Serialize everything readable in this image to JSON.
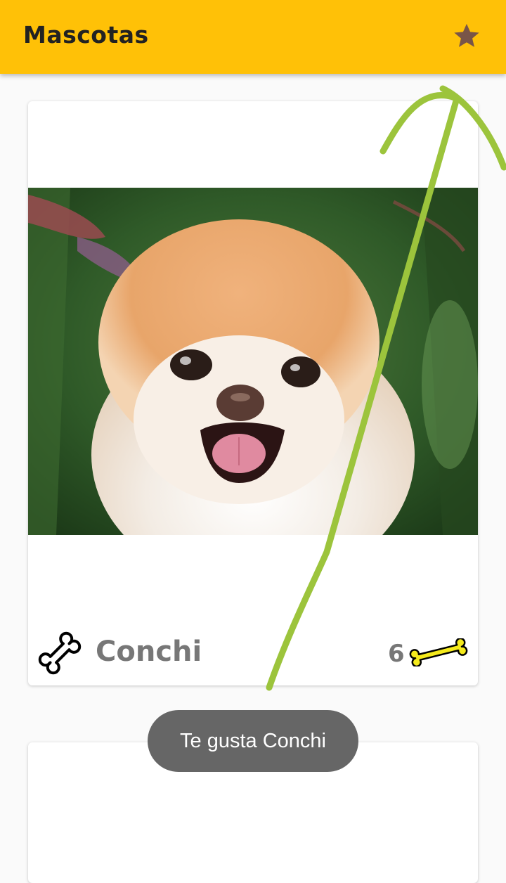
{
  "appbar": {
    "title": "Mascotas",
    "favorites_icon": "star-icon"
  },
  "pets": [
    {
      "name": "Conchi",
      "likes": "6",
      "rate_icon": "bone-outline-icon",
      "likes_icon": "yellow-bone-icon"
    }
  ],
  "toast": {
    "message": "Te gusta Conchi"
  },
  "colors": {
    "appbar": "#ffc107",
    "star": "#795548",
    "toast": "#666666",
    "annotation": "#9cc43c"
  }
}
